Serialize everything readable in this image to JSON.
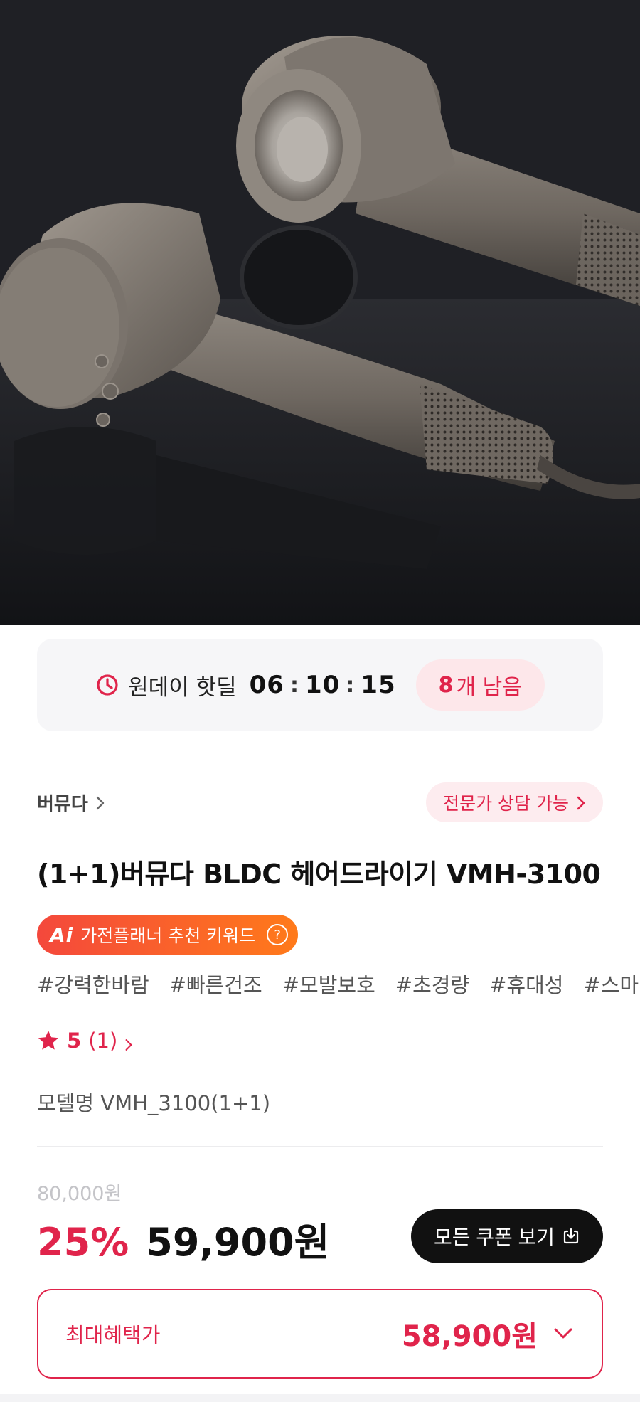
{
  "hero": {
    "image_alt": "hair dryer product image"
  },
  "deal": {
    "label": "원데이 핫딜",
    "hours": "06",
    "minutes": "10",
    "seconds": "15",
    "separator": ":",
    "remaining_count": "8",
    "remaining_suffix": "개 남음"
  },
  "brand": {
    "name": "버뮤다"
  },
  "consult": {
    "label": "전문가 상담 가능"
  },
  "product": {
    "title": "(1+1)버뮤다 BLDC 헤어드라이기 VMH-3100",
    "model_label": "모델명",
    "model_value": "VMH_3100(1+1)"
  },
  "ai_badge": {
    "logo": "Ai",
    "label": "가전플래너 추천 키워드",
    "help": "?"
  },
  "tags": [
    "#강력한바람",
    "#빠른건조",
    "#모발보호",
    "#초경량",
    "#휴대성",
    "#스마"
  ],
  "rating": {
    "score": "5",
    "count": "(1)"
  },
  "price": {
    "original": "80,000원",
    "discount": "25%",
    "current": "59,900원"
  },
  "coupon": {
    "label": "모든 쿠폰 보기"
  },
  "benefit": {
    "label": "최대혜택가",
    "price": "58,900원"
  },
  "colors": {
    "accent": "#e0244b",
    "badge_start": "#f4483c",
    "badge_end": "#ff7a1a"
  },
  "icons": [
    "clock-icon",
    "chevron-right-icon",
    "star-icon",
    "download-icon",
    "chevron-down-icon",
    "help-icon"
  ]
}
